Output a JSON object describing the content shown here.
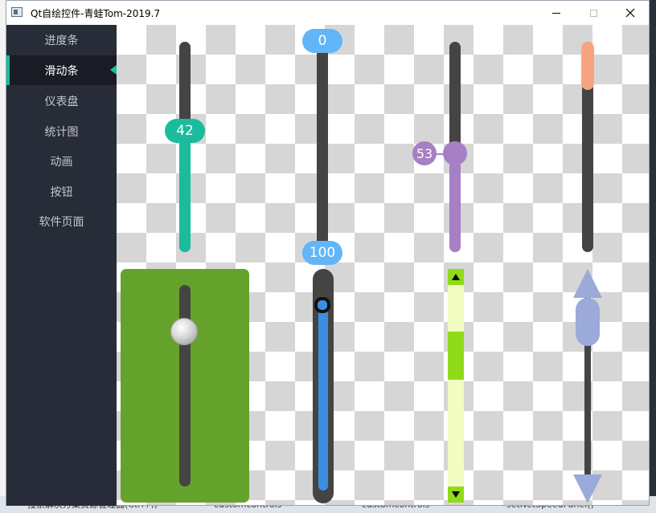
{
  "window": {
    "title": "Qt自绘控件-青蛙Tom-2019.7"
  },
  "nav": {
    "items": [
      {
        "label": "进度条"
      },
      {
        "label": "滑动条"
      },
      {
        "label": "仪表盘"
      },
      {
        "label": "统计图"
      },
      {
        "label": "动画"
      },
      {
        "label": "按钮"
      },
      {
        "label": "软件页面"
      }
    ],
    "active_index": 1
  },
  "sliders": {
    "teal": {
      "value": 42,
      "label": "42",
      "color": "#1abc9c"
    },
    "range_blue": {
      "min_label": "0",
      "max_label": "100",
      "color": "#62b5f7"
    },
    "purple": {
      "value": 53,
      "label": "53",
      "color": "#a67fc4"
    },
    "orange": {
      "color": "#f7a57f"
    },
    "green_panel": {
      "color": "#65a22c"
    },
    "blue_rounded": {
      "color": "#3b8fe0"
    },
    "lime_scrollbar": {
      "color": "#8fdb1a",
      "up_icon": "triangle-up",
      "down_icon": "triangle-down"
    },
    "periwinkle_scroll": {
      "color": "#9baad8"
    }
  },
  "taskbar_hint": {
    "search": "搜索解决方案资源管理器(Ctrl+;)",
    "item1": "customcontrols",
    "item2": "customcontrols",
    "item3": "setNetSpeedPanel()"
  }
}
